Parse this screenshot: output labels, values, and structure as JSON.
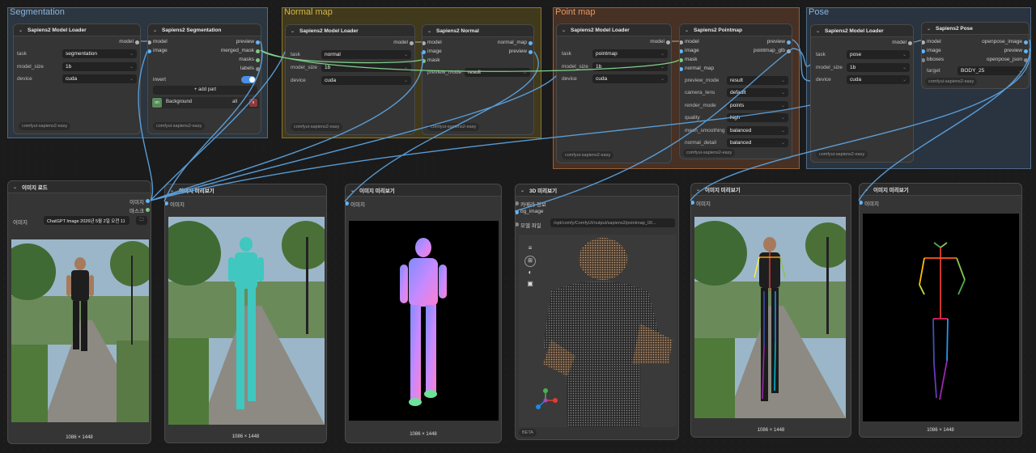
{
  "groups": {
    "segmentation": "Segmentation",
    "normal_map": "Normal map",
    "point_map": "Point map",
    "pose": "Pose"
  },
  "common": {
    "footer": "comfyui-sapiens2-easy",
    "model_port": "model",
    "image_port": "image",
    "task_label": "task",
    "model_size_label": "model_size",
    "device_label": "device",
    "model_size": "1b",
    "device": "cuda"
  },
  "seg_loader": {
    "title": "Sapiens2 Model Loader",
    "task": "segmentation"
  },
  "seg_node": {
    "title": "Sapiens2 Segmentation",
    "outputs": [
      "preview",
      "merged_mask",
      "masks",
      "labels"
    ],
    "invert_label": "invert",
    "add_part": "+ add part",
    "part_name": "Background",
    "part_value": "all",
    "part_tag": "on",
    "part_remove": "x"
  },
  "normal_loader": {
    "title": "Sapiens2 Model Loader",
    "task": "normal"
  },
  "normal_node": {
    "title": "Sapiens2 Normal",
    "inputs": [
      "model",
      "image",
      "mask"
    ],
    "outputs": [
      "normal_map",
      "preview"
    ],
    "preview_mode_label": "preview_mode",
    "preview_mode": "result"
  },
  "point_loader": {
    "title": "Sapiens2 Model Loader",
    "task": "pointmap"
  },
  "point_node": {
    "title": "Sapiens2 Pointmap",
    "inputs": [
      "model",
      "image",
      "mask",
      "normal_map"
    ],
    "outputs": [
      "preview",
      "pointmap_glb"
    ],
    "settings": [
      {
        "label": "preview_mode",
        "value": "result"
      },
      {
        "label": "camera_lens",
        "value": "default"
      },
      {
        "label": "render_mode",
        "value": "points"
      },
      {
        "label": "quality",
        "value": "high"
      },
      {
        "label": "mesh_smoothing",
        "value": "balanced"
      },
      {
        "label": "normal_detail",
        "value": "balanced"
      }
    ]
  },
  "pose_loader": {
    "title": "Sapiens2 Model Loader",
    "task": "pose"
  },
  "pose_node": {
    "title": "Sapiens2 Pose",
    "inputs": [
      "model",
      "image",
      "bboxes"
    ],
    "outputs": [
      "openpose_image",
      "preview",
      "openpose_json"
    ],
    "target_label": "target",
    "target": "BODY_25"
  },
  "load_image": {
    "title": "이미지 로드",
    "outputs": [
      "이미지",
      "마스크"
    ],
    "image_label": "이미지",
    "filename": "ChatGPT Image 2026년 5월 2일 오전 11...",
    "dims": "1086 × 1448"
  },
  "preview1": {
    "title": "이미지 미리보기",
    "input": "이미지",
    "dims": "1086 × 1448"
  },
  "preview2": {
    "title": "이미지 미리보기",
    "input": "이미지",
    "dims": "1086 × 1448"
  },
  "preview3d": {
    "title": "3D 미리보기",
    "inputs": [
      "카메라 정보",
      "bg_image",
      "모델 파일"
    ],
    "path": "/opt/comfy/ComfyUI/output/sapiens2/pointmap_00...",
    "beta": "BETA"
  },
  "preview4": {
    "title": "이미지 미리보기",
    "input": "이미지",
    "dims": "1086 × 1448"
  },
  "preview5": {
    "title": "이미지 미리보기",
    "input": "이미지",
    "dims": "1086 × 1448"
  },
  "colors": {
    "model_port": "#b0b0b0",
    "image_port": "#64b5f6",
    "mask_port": "#81c784",
    "link": "#6ab0e8",
    "toggle": "#4a90e2"
  }
}
